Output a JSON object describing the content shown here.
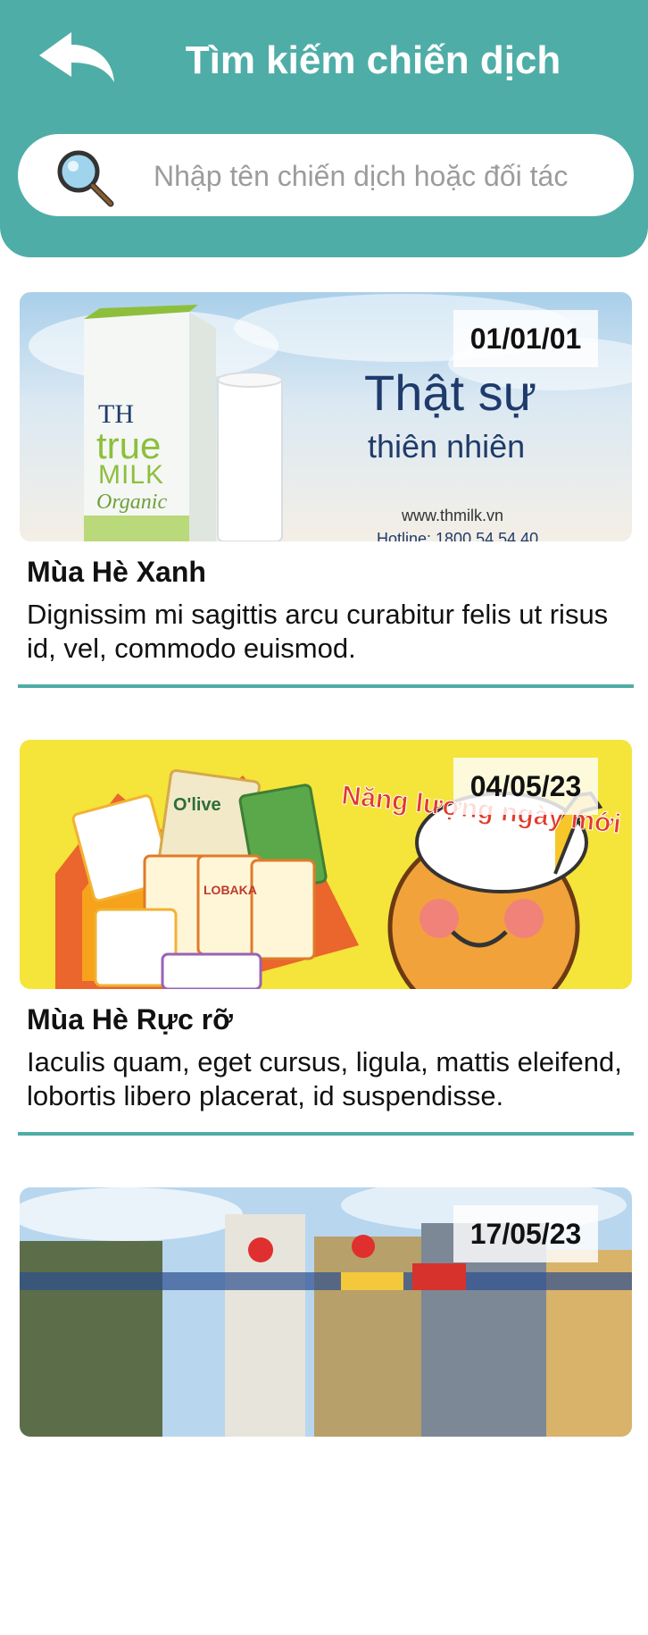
{
  "header": {
    "title": "Tìm kiếm chiến dịch",
    "back_icon": "back-arrow-icon"
  },
  "search": {
    "icon": "magnifier-icon",
    "placeholder": "Nhập tên chiến dịch hoặc đối tác",
    "value": ""
  },
  "campaigns": [
    {
      "date": "01/01/01",
      "title": "Mùa Hè Xanh",
      "description": "Dignissim mi sagittis arcu curabitur felis ut risus id, vel, commodo euismod.",
      "banner": {
        "brand_top": "TH",
        "brand_mid": "true",
        "brand_low": "MILK",
        "brand_sub": "Organic",
        "headline": "Thật sự",
        "subheadline": "thiên nhiên",
        "website": "www.thmilk.vn",
        "hotline": "Hotline: 1800 54 54 40"
      }
    },
    {
      "date": "04/05/23",
      "title": "Mùa Hè Rực rỡ",
      "description": "Iaculis quam, eget cursus, ligula, mattis eleifend, lobortis libero placerat, id suspendisse.",
      "banner": {
        "tagline": "Năng lượng ngày mới",
        "pack_label_1": "O'live",
        "pack_label_2": "LOBAKA"
      }
    },
    {
      "date": "17/05/23",
      "title": "",
      "description": "",
      "banner": {}
    }
  ],
  "colors": {
    "accent": "#4fada7",
    "milk_blue": "#1f3b6b",
    "milk_green": "#8dbf3c",
    "snack_yellow": "#f5e43a"
  }
}
